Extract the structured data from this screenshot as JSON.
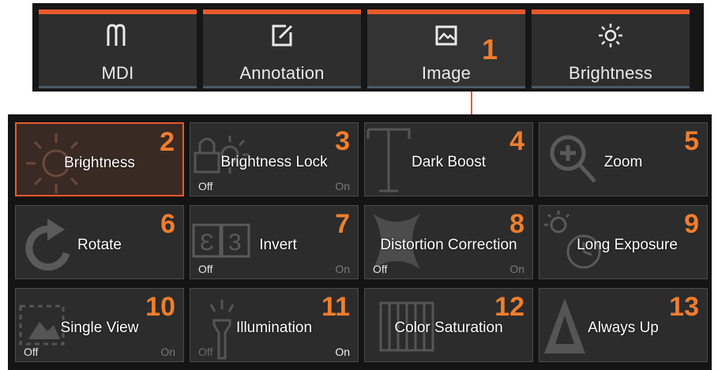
{
  "tabs": [
    {
      "id": "mdi",
      "label": "MDI",
      "icon": "mdi-icon"
    },
    {
      "id": "annotation",
      "label": "Annotation",
      "icon": "annotation-icon"
    },
    {
      "id": "image",
      "label": "Image",
      "icon": "image-icon",
      "active": true
    },
    {
      "id": "brightness",
      "label": "Brightness",
      "icon": "sun-icon"
    }
  ],
  "tab_callout": "1",
  "menu": {
    "items": [
      {
        "label": "Brightness",
        "callout": "2",
        "icon": "sun-icon",
        "selected": true
      },
      {
        "label": "Brightness Lock",
        "callout": "3",
        "icon": "lock-sun-icon",
        "toggle": {
          "off": "Off",
          "on": "On",
          "state": "Off"
        }
      },
      {
        "label": "Dark Boost",
        "callout": "4",
        "icon": "text-t-icon"
      },
      {
        "label": "Zoom",
        "callout": "5",
        "icon": "zoom-in-icon"
      },
      {
        "label": "Rotate",
        "callout": "6",
        "icon": "rotate-icon"
      },
      {
        "label": "Invert",
        "callout": "7",
        "icon": "invert-icon",
        "toggle": {
          "off": "Off",
          "on": "On",
          "state": "Off"
        }
      },
      {
        "label": "Distortion Correction",
        "callout": "8",
        "icon": "distortion-icon",
        "toggle": {
          "off": "Off",
          "on": "On",
          "state": "Off"
        }
      },
      {
        "label": "Long Exposure",
        "callout": "9",
        "icon": "long-exposure-icon"
      },
      {
        "label": "Single View",
        "callout": "10",
        "icon": "single-view-icon",
        "toggle": {
          "off": "Off",
          "on": "On",
          "state": "Off"
        }
      },
      {
        "label": "Illumination",
        "callout": "11",
        "icon": "flashlight-icon",
        "toggle": {
          "off": "Off",
          "on": "On",
          "state": "On"
        }
      },
      {
        "label": "Color Saturation",
        "callout": "12",
        "icon": "color-saturation-icon"
      },
      {
        "label": "Always Up",
        "callout": "13",
        "icon": "always-up-icon"
      }
    ]
  },
  "colors": {
    "accent": "#e8592b",
    "callout": "#f07e2c",
    "panel": "#141414",
    "card": "#2c2c2c"
  }
}
